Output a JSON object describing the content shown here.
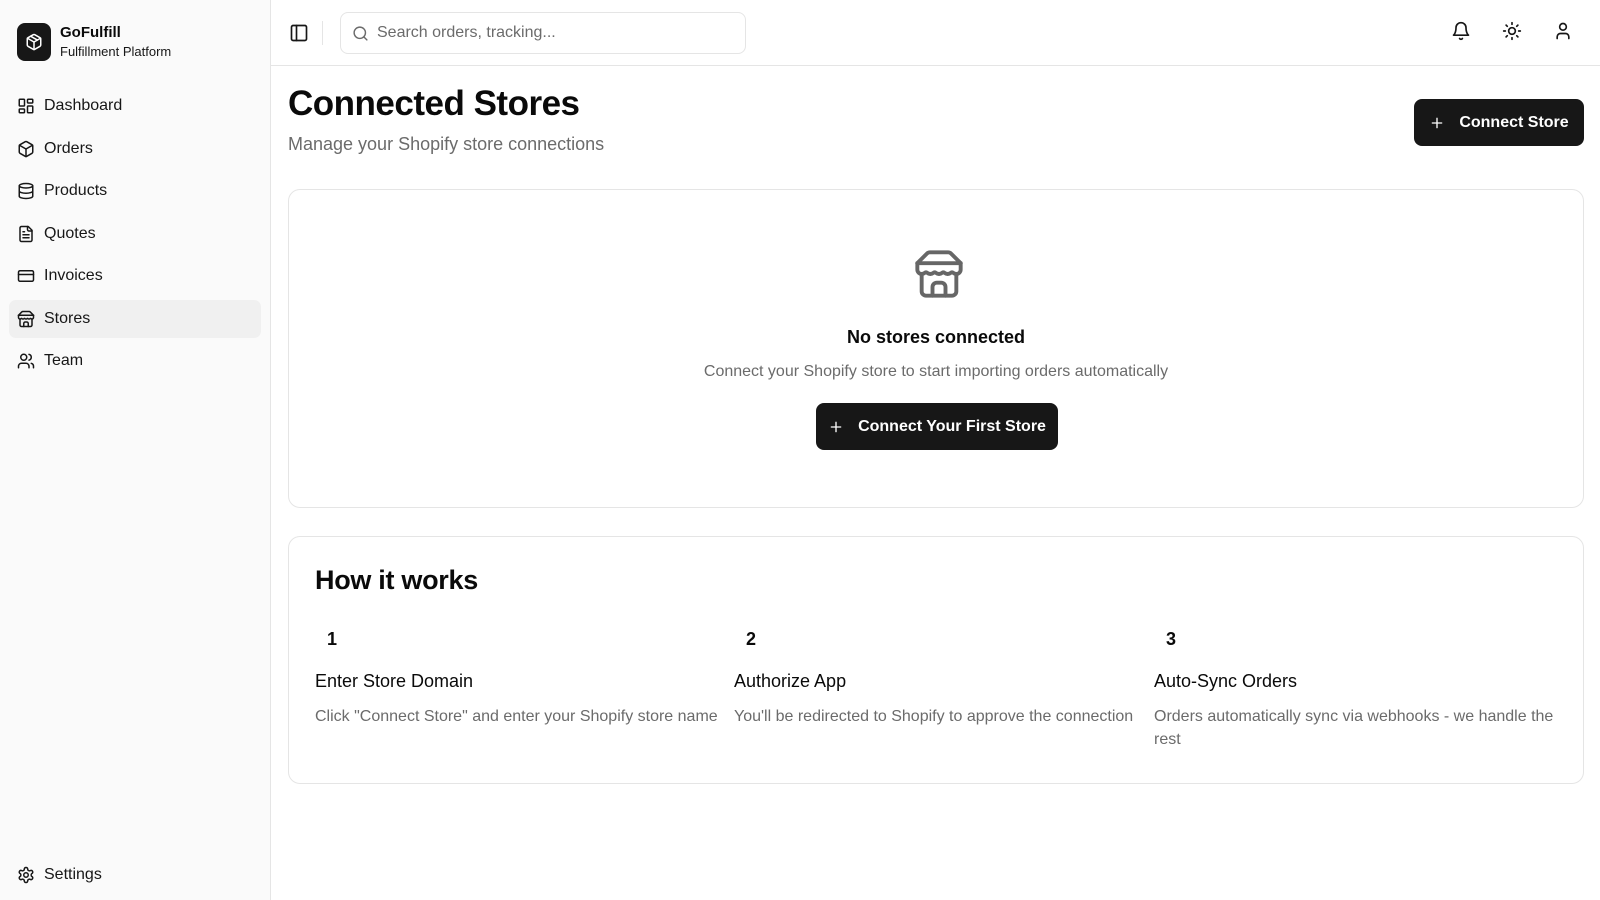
{
  "brand": {
    "name": "GoFulfill",
    "subtitle": "Fulfillment Platform",
    "icon": "box-icon"
  },
  "sidebar": {
    "items": [
      {
        "label": "Dashboard",
        "icon": "layout-grid-icon",
        "active": false
      },
      {
        "label": "Orders",
        "icon": "package-icon",
        "active": false
      },
      {
        "label": "Products",
        "icon": "database-icon",
        "active": false
      },
      {
        "label": "Quotes",
        "icon": "file-text-icon",
        "active": false
      },
      {
        "label": "Invoices",
        "icon": "credit-card-icon",
        "active": false
      },
      {
        "label": "Stores",
        "icon": "store-icon",
        "active": true
      },
      {
        "label": "Team",
        "icon": "users-icon",
        "active": false
      }
    ],
    "settings_label": "Settings"
  },
  "topbar": {
    "search_placeholder": "Search orders, tracking...",
    "icons": [
      "sidebar-toggle-icon",
      "bell-icon",
      "sun-icon",
      "user-icon"
    ]
  },
  "page": {
    "title": "Connected Stores",
    "subtitle": "Manage your Shopify store connections",
    "connect_button": "Connect Store"
  },
  "empty_state": {
    "title": "No stores connected",
    "description": "Connect your Shopify store to start importing orders automatically",
    "button": "Connect Your First Store"
  },
  "how_it_works": {
    "title": "How it works",
    "steps": [
      {
        "number": "1",
        "title": "Enter Store Domain",
        "description": "Click \"Connect Store\" and enter your Shopify store name"
      },
      {
        "number": "2",
        "title": "Authorize App",
        "description": "You'll be redirected to Shopify to approve the connection"
      },
      {
        "number": "3",
        "title": "Auto-Sync Orders",
        "description": "Orders automatically sync via webhooks - we handle the rest"
      }
    ]
  },
  "colors": {
    "primary": "#171717",
    "muted_text": "#6b6b6b",
    "border": "#e5e5e5",
    "sidebar_bg": "#fafafa",
    "active_item_bg": "#f0f0f0"
  }
}
